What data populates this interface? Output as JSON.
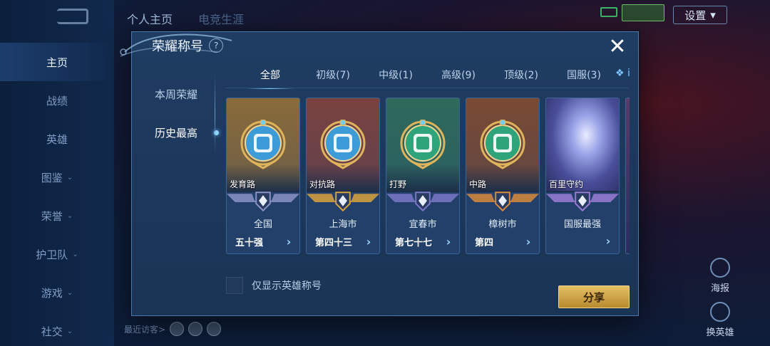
{
  "background": {
    "top_tabs": [
      "个人主页",
      "电竞生涯"
    ],
    "settings_label": "设置",
    "side_nav": [
      {
        "label": "主页",
        "active": true,
        "chevron": false
      },
      {
        "label": "战绩",
        "active": false,
        "chevron": false
      },
      {
        "label": "英雄",
        "active": false,
        "chevron": false
      },
      {
        "label": "图鉴",
        "active": false,
        "chevron": true
      },
      {
        "label": "荣誉",
        "active": false,
        "chevron": true
      },
      {
        "label": "护卫队",
        "active": false,
        "chevron": true
      },
      {
        "label": "游戏",
        "active": false,
        "chevron": true
      },
      {
        "label": "社交",
        "active": false,
        "chevron": true
      }
    ],
    "right_buttons": [
      "海报",
      "换英雄"
    ],
    "visitors_label": "最近访客>"
  },
  "modal": {
    "title": "荣耀称号",
    "help_icon": "question-diamond-icon",
    "close_icon": "close-icon",
    "left_menu": [
      {
        "label": "本周荣耀",
        "active": false
      },
      {
        "label": "历史最高",
        "active": true
      }
    ],
    "tabs": [
      {
        "label": "全部",
        "active": true
      },
      {
        "label": "初级(7)",
        "active": false
      },
      {
        "label": "中级(1)",
        "active": false
      },
      {
        "label": "高级(9)",
        "active": false
      },
      {
        "label": "顶级(2)",
        "active": false
      },
      {
        "label": "国服(3)",
        "active": false
      }
    ],
    "tab_overflow": "❖ i",
    "cards": [
      {
        "place": "发育路",
        "region": "全国",
        "rank": "五十强",
        "bg": "#8a6b3a",
        "emblem_color": "#3d9bd8",
        "banner_color": "#8a93c4"
      },
      {
        "place": "对抗路",
        "region": "上海市",
        "rank": "第四十三",
        "bg": "#7a4240",
        "emblem_color": "#3d9bd8",
        "banner_color": "#d9a23a"
      },
      {
        "place": "打野",
        "region": "宜春市",
        "rank": "第七十七",
        "bg": "#2f6a5c",
        "emblem_color": "#2fa37a",
        "banner_color": "#7a78c8"
      },
      {
        "place": "中路",
        "region": "樟树市",
        "rank": "第四",
        "bg": "#7a4a34",
        "emblem_color": "#2fa37a",
        "banner_color": "#d98a3a"
      },
      {
        "place": "百里守约",
        "region": "国服最强",
        "rank": "",
        "bg": "#6b6fb0",
        "emblem_color": "",
        "banner_color": "#9a7cd6"
      }
    ],
    "checkbox_label": "仅显示英雄称号",
    "share_label": "分享"
  }
}
